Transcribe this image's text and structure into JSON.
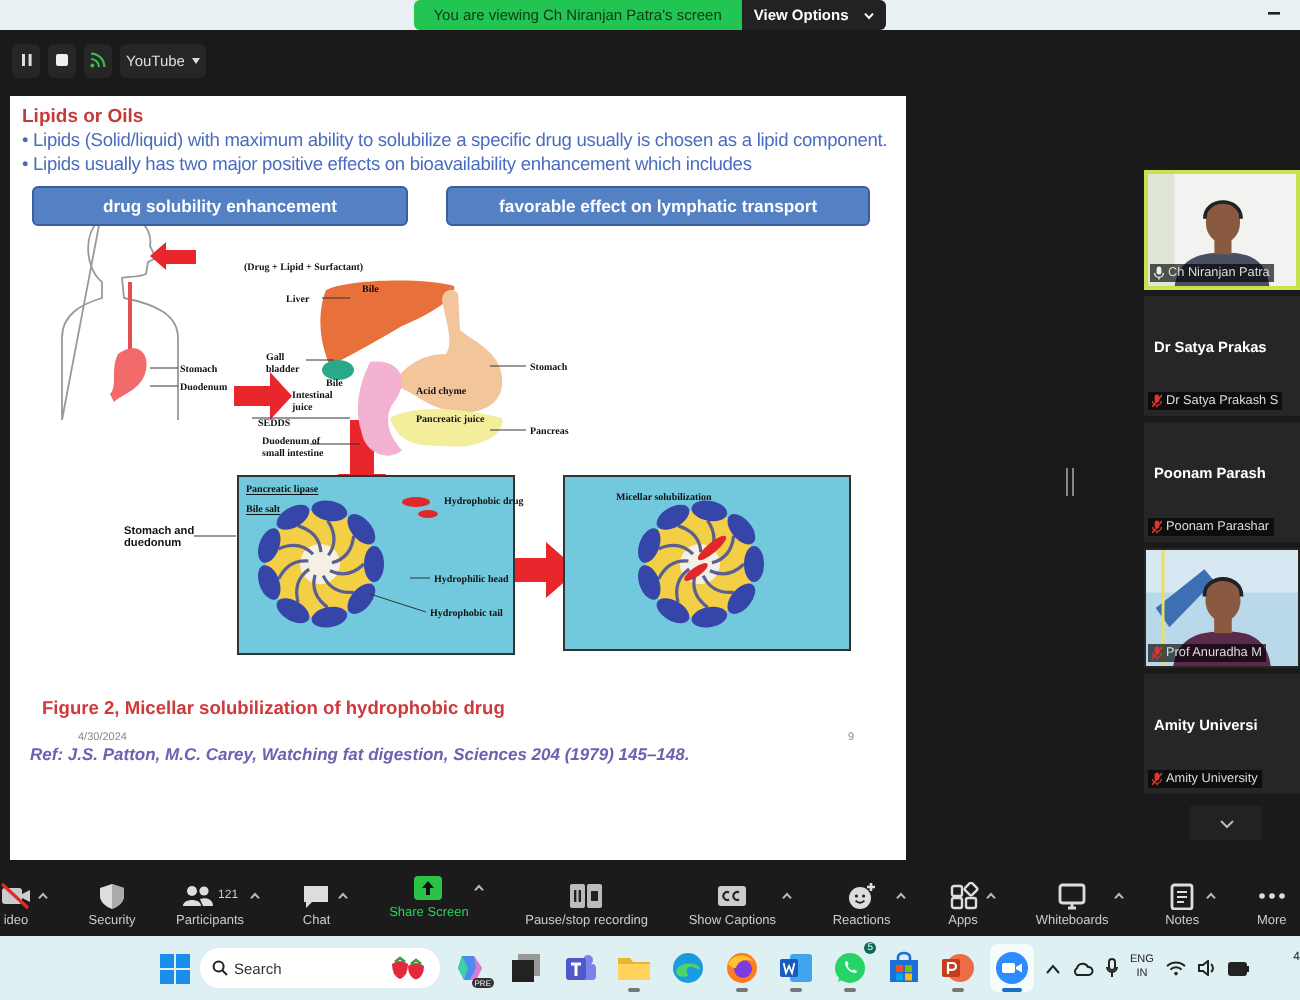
{
  "top_bar": {
    "banner": "You are viewing Ch Niranjan Patra's screen",
    "view_options": "View Options"
  },
  "share_toolbar": {
    "source": "YouTube"
  },
  "slide": {
    "title": "Lipids or Oils",
    "bullets": [
      "• Lipids (Solid/liquid) with maximum ability to solubilize a specific drug usually is chosen as a lipid component.",
      "• Lipids usually has two major positive effects on bioavailability enhancement which includes"
    ],
    "highlights": [
      "drug solubility enhancement",
      "favorable effect on lymphatic transport"
    ],
    "diagram_labels": [
      {
        "lines": [
          "(Drug + Lipid + Surfactant)"
        ]
      },
      {
        "lines": [
          "Liver"
        ]
      },
      {
        "lines": [
          "Bile"
        ]
      },
      {
        "lines": [
          "Gall",
          "bladder"
        ]
      },
      {
        "lines": [
          "Bile"
        ]
      },
      {
        "lines": [
          "Stomach"
        ]
      },
      {
        "lines": [
          "Intestinal",
          "juice"
        ]
      },
      {
        "lines": [
          "Acid chyme"
        ]
      },
      {
        "lines": [
          "SEDDS"
        ]
      },
      {
        "lines": [
          "Pancreatic juice"
        ]
      },
      {
        "lines": [
          "Pancreas"
        ]
      },
      {
        "lines": [
          "Duodenum of",
          "small intestine"
        ]
      },
      {
        "lines": [
          "Stomach"
        ]
      },
      {
        "lines": [
          "Duodenum"
        ]
      },
      {
        "lines": [
          "Stomach and",
          "duedonum"
        ]
      },
      {
        "lines": [
          "Pancreatic lipase"
        ]
      },
      {
        "lines": [
          "Bile salt"
        ]
      },
      {
        "lines": [
          "Hydrophobic drug"
        ]
      },
      {
        "lines": [
          "Hydrophilic head"
        ]
      },
      {
        "lines": [
          "Hydrophobic tail"
        ]
      },
      {
        "lines": [
          "Micellar solubilization"
        ]
      }
    ],
    "caption": "Figure 2, Micellar solubilization of hydrophobic drug",
    "date": "4/30/2024",
    "page": "9",
    "reference": "Ref: J.S. Patton, M.C. Carey, Watching fat digestion, Sciences 204 (1979) 145–148."
  },
  "participants": [
    {
      "kind": "video",
      "name": "Ch Niranjan Patra",
      "muted": false,
      "active": true
    },
    {
      "kind": "avatar",
      "display": "Dr Satya Prakas",
      "name": "Dr Satya Prakash S",
      "muted": true,
      "active": false
    },
    {
      "kind": "avatar",
      "display": "Poonam Parash",
      "name": "Poonam Parashar",
      "muted": true,
      "active": false
    },
    {
      "kind": "video",
      "name": "Prof Anuradha M",
      "muted": true,
      "active": false
    },
    {
      "kind": "avatar",
      "display": "Amity Universi",
      "name": "Amity University",
      "muted": true,
      "active": false
    }
  ],
  "meeting_toolbar": [
    {
      "kind": "video",
      "label": "ideo",
      "caret": true
    },
    {
      "kind": "security",
      "label": "Security",
      "caret": false
    },
    {
      "kind": "participants",
      "label": "Participants",
      "count": "121",
      "caret": true
    },
    {
      "kind": "chat",
      "label": "Chat",
      "caret": true
    },
    {
      "kind": "share",
      "label": "Share Screen",
      "caret": true
    },
    {
      "kind": "record",
      "label": "Pause/stop recording",
      "caret": false
    },
    {
      "kind": "captions",
      "label": "Show Captions",
      "caret": true
    },
    {
      "kind": "reactions",
      "label": "Reactions",
      "caret": true
    },
    {
      "kind": "apps",
      "label": "Apps",
      "caret": true
    },
    {
      "kind": "whiteboards",
      "label": "Whiteboards",
      "caret": true
    },
    {
      "kind": "notes",
      "label": "Notes",
      "caret": true
    },
    {
      "kind": "more",
      "label": "More",
      "caret": false
    }
  ],
  "taskbar": {
    "search": {
      "placeholder": "Search"
    },
    "apps": [
      {
        "kind": "copilot",
        "badge": "PRE",
        "running": false,
        "selected": false
      },
      {
        "kind": "taskview",
        "running": false,
        "selected": false
      },
      {
        "kind": "teams",
        "running": false,
        "selected": false
      },
      {
        "kind": "files",
        "running": true,
        "selected": false
      },
      {
        "kind": "edge",
        "running": false,
        "selected": false
      },
      {
        "kind": "firefox",
        "running": true,
        "selected": false
      },
      {
        "kind": "word",
        "running": true,
        "selected": false
      },
      {
        "kind": "whatsapp",
        "badge": "5",
        "running": true,
        "selected": false
      },
      {
        "kind": "store",
        "running": false,
        "selected": false
      },
      {
        "kind": "powerpoint",
        "running": true,
        "selected": false
      },
      {
        "kind": "zoom",
        "running": true,
        "selected": true
      }
    ],
    "language": [
      "ENG",
      "IN"
    ],
    "clock": "4"
  }
}
